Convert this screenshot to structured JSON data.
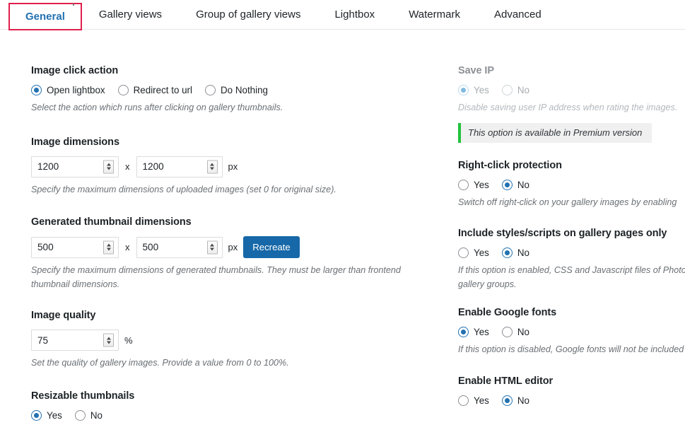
{
  "tabs": [
    {
      "label": "General",
      "active": true
    },
    {
      "label": "Gallery views",
      "active": false
    },
    {
      "label": "Group of gallery views",
      "active": false
    },
    {
      "label": "Lightbox",
      "active": false
    },
    {
      "label": "Watermark",
      "active": false
    },
    {
      "label": "Advanced",
      "active": false
    }
  ],
  "left": {
    "image_click_action": {
      "label": "Image click action",
      "options": [
        {
          "label": "Open lightbox",
          "selected": true
        },
        {
          "label": "Redirect to url",
          "selected": false
        },
        {
          "label": "Do Nothing",
          "selected": false
        }
      ],
      "desc": "Select the action which runs after clicking on gallery thumbnails."
    },
    "image_dimensions": {
      "label": "Image dimensions",
      "width": "1200",
      "height": "1200",
      "separator": "x",
      "unit": "px",
      "desc": "Specify the maximum dimensions of uploaded images (set 0 for original size)."
    },
    "thumbnail_dimensions": {
      "label": "Generated thumbnail dimensions",
      "width": "500",
      "height": "500",
      "separator": "x",
      "unit": "px",
      "button": "Recreate",
      "desc": "Specify the maximum dimensions of generated thumbnails. They must be larger than frontend thumbnail dimensions."
    },
    "image_quality": {
      "label": "Image quality",
      "value": "75",
      "unit": "%",
      "desc": "Set the quality of gallery images. Provide a value from 0 to 100%."
    },
    "resizable_thumbnails": {
      "label": "Resizable thumbnails",
      "options": [
        {
          "label": "Yes",
          "selected": true
        },
        {
          "label": "No",
          "selected": false
        }
      ]
    }
  },
  "right": {
    "save_ip": {
      "label": "Save IP",
      "disabled": true,
      "options": [
        {
          "label": "Yes",
          "selected": true
        },
        {
          "label": "No",
          "selected": false
        }
      ],
      "desc": "Disable saving user IP address when rating the images.",
      "premium_notice": "This option is available in Premium version"
    },
    "right_click_protection": {
      "label": "Right-click protection",
      "options": [
        {
          "label": "Yes",
          "selected": false
        },
        {
          "label": "No",
          "selected": true
        }
      ],
      "desc": "Switch off right-click on your gallery images by enabling"
    },
    "include_styles": {
      "label": "Include styles/scripts on gallery pages only",
      "options": [
        {
          "label": "Yes",
          "selected": false
        },
        {
          "label": "No",
          "selected": true
        }
      ],
      "desc": "If this option is enabled, CSS and Javascript files of Photo and gallery groups."
    },
    "google_fonts": {
      "label": "Enable Google fonts",
      "options": [
        {
          "label": "Yes",
          "selected": true
        },
        {
          "label": "No",
          "selected": false
        }
      ],
      "desc": "If this option is disabled, Google fonts will not be included"
    },
    "html_editor": {
      "label": "Enable HTML editor",
      "options": [
        {
          "label": "Yes",
          "selected": false
        },
        {
          "label": "No",
          "selected": true
        }
      ]
    }
  },
  "colors": {
    "accent_blue": "#2271b1",
    "button_blue": "#1668a8",
    "active_tab_border": "#e01f4c",
    "premium_green": "#20c33b"
  }
}
